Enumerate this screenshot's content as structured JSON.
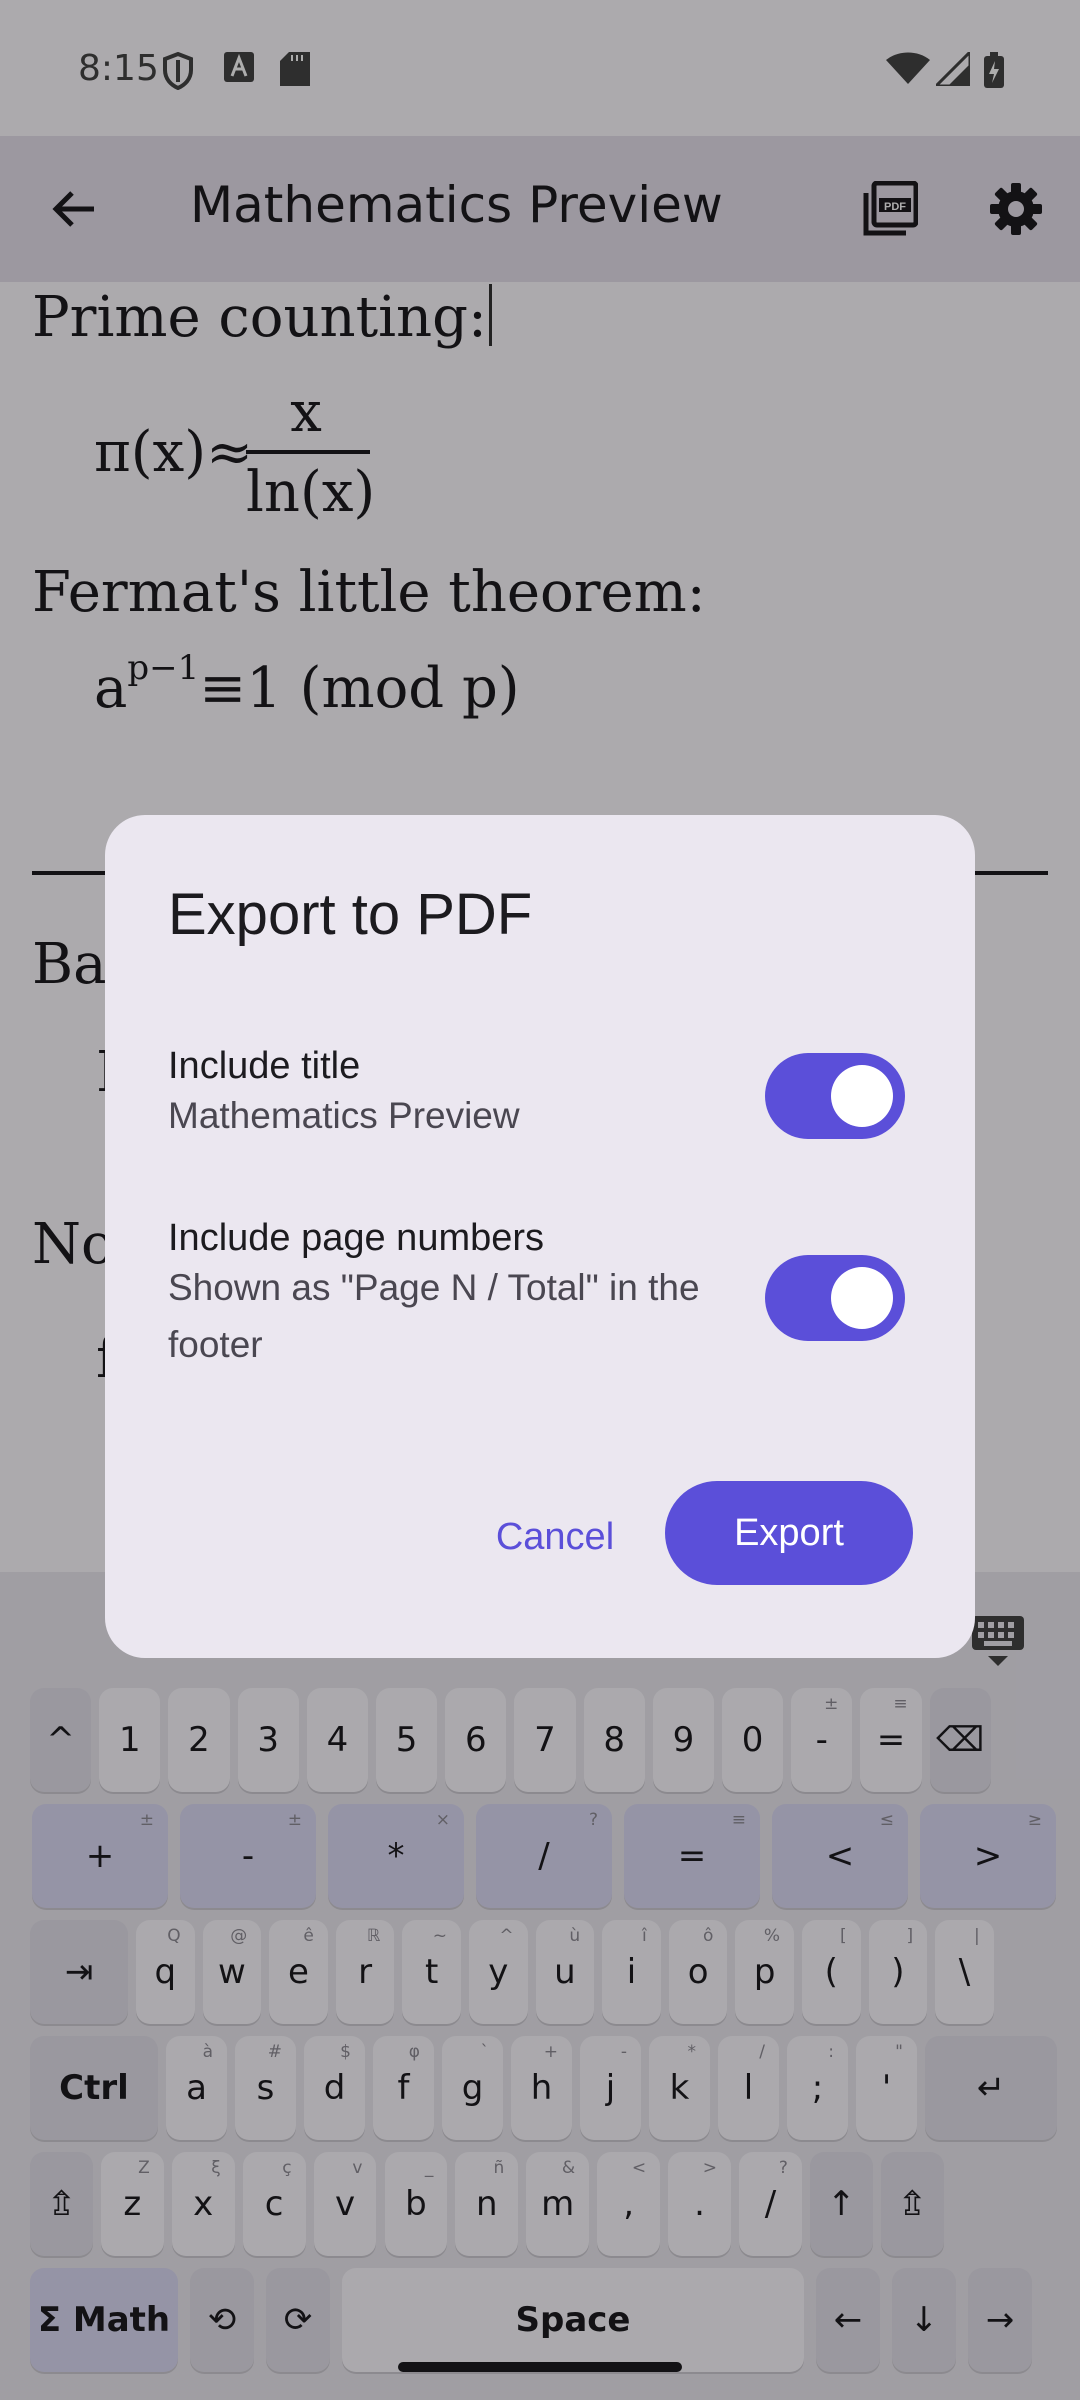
{
  "status_bar": {
    "time": "8:15",
    "icons": [
      "shield-icon",
      "font-a-icon",
      "sd-card-icon",
      "wifi-icon",
      "cell-signal-icon",
      "battery-icon"
    ]
  },
  "app_bar": {
    "title": "Mathematics Preview",
    "back_icon": "arrow-back-icon",
    "pdf_icon": "pdf-icon",
    "settings_icon": "gear-icon"
  },
  "document": {
    "line1": "Prime counting:",
    "pi_lhs": "π(x)≈",
    "pi_num": "x",
    "pi_den": "ln(x)",
    "line2": "Fermat's little theorem:",
    "fermat_base": "a",
    "fermat_exp": "p−1",
    "fermat_rest": "≡1 (mod p)",
    "partial_1": "Bay",
    "partial_2": "P",
    "partial_3": "No",
    "partial_4": "f"
  },
  "dialog": {
    "title": "Export to PDF",
    "options": [
      {
        "label": "Include title",
        "sub": "Mathematics Preview",
        "enabled": true
      },
      {
        "label": "Include page numbers",
        "sub": "Shown as \"Page N / Total\" in the footer",
        "enabled": true
      }
    ],
    "cancel_label": "Cancel",
    "export_label": "Export"
  },
  "keyboard": {
    "toggle_icon": "keyboard-hide-icon",
    "rows": [
      [
        {
          "k": "^"
        },
        {
          "k": "1"
        },
        {
          "k": "2"
        },
        {
          "k": "3"
        },
        {
          "k": "4"
        },
        {
          "k": "5"
        },
        {
          "k": "6"
        },
        {
          "k": "7"
        },
        {
          "k": "8"
        },
        {
          "k": "9"
        },
        {
          "k": "0"
        },
        {
          "k": "-",
          "h": "±"
        },
        {
          "k": "=",
          "h": "≡"
        },
        {
          "k": "⌫"
        }
      ],
      [
        {
          "k": "+",
          "h": "±"
        },
        {
          "k": "-",
          "h": "±"
        },
        {
          "k": "*",
          "h": "×"
        },
        {
          "k": "/",
          "h": "?"
        },
        {
          "k": "=",
          "h": "≡"
        },
        {
          "k": "<",
          "h": "≤"
        },
        {
          "k": ">",
          "h": "≥"
        }
      ],
      [
        {
          "k": "⇥"
        },
        {
          "k": "q",
          "h": "Q"
        },
        {
          "k": "w",
          "h": "@"
        },
        {
          "k": "e",
          "h": "ê"
        },
        {
          "k": "r",
          "h": "ℝ"
        },
        {
          "k": "t",
          "h": "~"
        },
        {
          "k": "y",
          "h": "^"
        },
        {
          "k": "u",
          "h": "ù"
        },
        {
          "k": "i",
          "h": "î"
        },
        {
          "k": "o",
          "h": "ô"
        },
        {
          "k": "p",
          "h": "%"
        },
        {
          "k": "(",
          "h": "["
        },
        {
          "k": ")",
          "h": "]"
        },
        {
          "k": "\\",
          "h": "|"
        }
      ],
      [
        {
          "k": "Ctrl"
        },
        {
          "k": "a",
          "h": "à"
        },
        {
          "k": "s",
          "h": "#"
        },
        {
          "k": "d",
          "h": "$"
        },
        {
          "k": "f",
          "h": "φ"
        },
        {
          "k": "g",
          "h": "`"
        },
        {
          "k": "h",
          "h": "+"
        },
        {
          "k": "j",
          "h": "-"
        },
        {
          "k": "k",
          "h": "*"
        },
        {
          "k": "l",
          "h": "/"
        },
        {
          "k": ";",
          "h": ":"
        },
        {
          "k": "'",
          "h": "\""
        },
        {
          "k": "↵"
        }
      ],
      [
        {
          "k": "⇬"
        },
        {
          "k": "z",
          "h": "Z"
        },
        {
          "k": "x",
          "h": "ξ"
        },
        {
          "k": "c",
          "h": "ç"
        },
        {
          "k": "v",
          "h": "v"
        },
        {
          "k": "b",
          "h": "_"
        },
        {
          "k": "n",
          "h": "ñ"
        },
        {
          "k": "m",
          "h": "&"
        },
        {
          "k": ",",
          "h": "<"
        },
        {
          "k": ".",
          "h": ">"
        },
        {
          "k": "/",
          "h": "?"
        },
        {
          "k": "↑"
        },
        {
          "k": "⇬"
        }
      ],
      [
        {
          "k": "Σ Math"
        },
        {
          "k": "⟲"
        },
        {
          "k": "⟳"
        },
        {
          "k": "Space"
        },
        {
          "k": "←"
        },
        {
          "k": "↓"
        },
        {
          "k": "→"
        }
      ]
    ]
  },
  "colors": {
    "accent": "#5b4fd9",
    "dialog_bg": "#ebe7f0",
    "app_bar_bg": "#e6e1ec"
  }
}
